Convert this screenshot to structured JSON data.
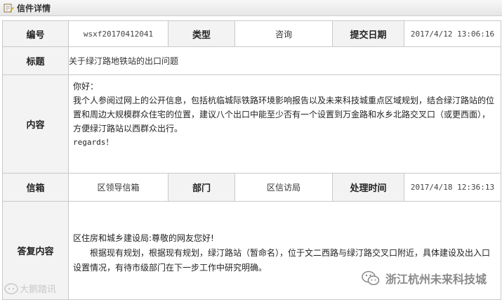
{
  "header": {
    "title": "信件详情"
  },
  "row1": {
    "number_label": "编号",
    "number_value": "wsxf20170412041",
    "type_label": "类型",
    "type_value": "咨询",
    "date_label": "提交日期",
    "date_value": "2017/4/12 13:06:16"
  },
  "row_title": {
    "label": "标题",
    "value": "关于绿汀路地铁站的出口问题"
  },
  "row_content": {
    "label": "内容",
    "greeting": "你好：",
    "body": "我个人参阅过网上的公开信息，包括杭临城际铁路环境影响报告以及未来科技城重点区域规划，结合绿汀路站的位置和周边大规模群众住宅的位置，建议八个出口中能至少否有一个设置到万金路和水乡北路交叉口（或更西面），方便绿汀路站以西群众出行。",
    "regards": "regards！"
  },
  "row3": {
    "mailbox_label": "信箱",
    "mailbox_value": "区领导信箱",
    "dept_label": "部门",
    "dept_value": "区信访局",
    "time_label": "处理时间",
    "time_value": "2017/4/18 12:36:13"
  },
  "row_reply": {
    "label": "答复内容",
    "salutation": "区住房和城乡建设局:尊敬的网友您好!",
    "body": "根据现有规划，根据现有规划，绿汀路站（暂命名），位于文二西路与绿汀路交叉口附近，具体建设及出入口设置情况，有待市级部门在下一步工作中研究明确。"
  },
  "watermarks": {
    "left": "大鹅踏讯",
    "right": "浙江杭州未来科技城"
  }
}
